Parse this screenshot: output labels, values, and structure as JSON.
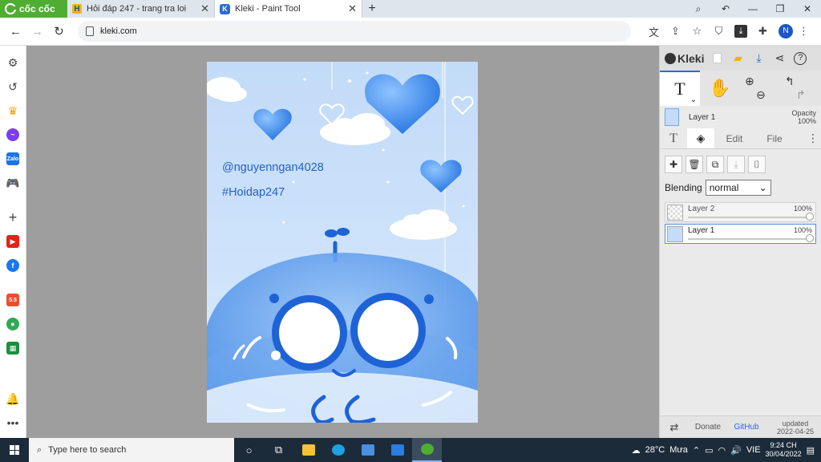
{
  "browser": {
    "brand": "cốc cốc",
    "tabs": [
      {
        "title": "Hỏi đáp 247 - trang tra loi",
        "active": false
      },
      {
        "title": "Kleki - Paint Tool",
        "active": true
      }
    ],
    "url": "kleki.com",
    "profile_initial": "N"
  },
  "canvas": {
    "texts": [
      "@nguyenngan4028",
      "#Hoidap247"
    ],
    "colors": {
      "background": "#c4dcf8",
      "accent": "#1e63d6",
      "text": "#2362c4"
    }
  },
  "panel": {
    "logo": "Kleki",
    "tool_glyph": "T",
    "current_layer": {
      "name": "Layer 1",
      "opacity_label": "Opacity",
      "opacity_value": "100%"
    },
    "tabs": {
      "text_glyph": "T",
      "edit": "Edit",
      "file": "File"
    },
    "blending_label": "Blending",
    "blending_value": "normal",
    "layers": [
      {
        "name": "Layer 2",
        "opacity": "100%",
        "active": false
      },
      {
        "name": "Layer 1",
        "opacity": "100%",
        "active": true
      }
    ],
    "footer": {
      "donate": "Donate",
      "github": "GitHub",
      "updated_label": "updated",
      "updated_date": "2022-04-25"
    }
  },
  "taskbar": {
    "search_placeholder": "Type here to search",
    "weather": "28°C",
    "weather_desc": "Mưa",
    "language": "VIE",
    "time": "9:24 CH",
    "date": "30/04/2022"
  }
}
